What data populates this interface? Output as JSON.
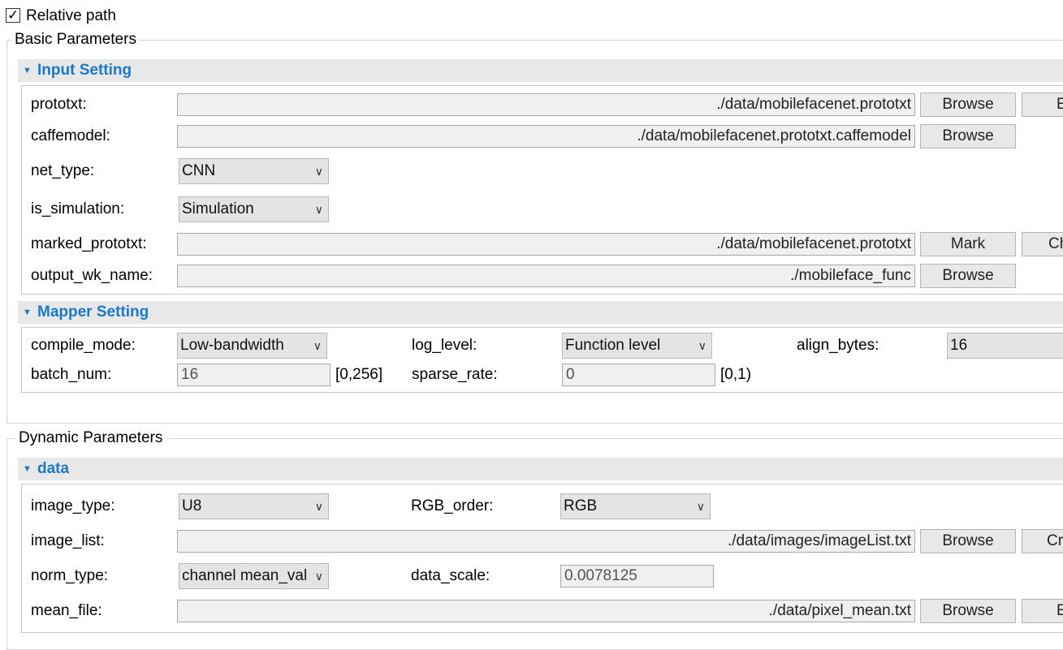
{
  "relative_path": {
    "label": "Relative path",
    "checked": true
  },
  "basic": {
    "group_title": "Basic Parameters",
    "input_setting": {
      "title": "Input Setting",
      "prototxt": {
        "label": "prototxt:",
        "value": "./data/mobilefacenet.prototxt",
        "button": "Browse",
        "extra_button": "E"
      },
      "caffemodel": {
        "label": "caffemodel:",
        "value": "./data/mobilefacenet.prototxt.caffemodel",
        "button": "Browse"
      },
      "net_type": {
        "label": "net_type:",
        "value": "CNN"
      },
      "is_simulation": {
        "label": "is_simulation:",
        "value": "Simulation"
      },
      "marked_prototxt": {
        "label": "marked_prototxt:",
        "value": "./data/mobilefacenet.prototxt",
        "button": "Mark",
        "extra_button": "Ch"
      },
      "output_wk_name": {
        "label": "output_wk_name:",
        "value": "./mobileface_func",
        "button": "Browse"
      }
    },
    "mapper_setting": {
      "title": "Mapper Setting",
      "compile_mode": {
        "label": "compile_mode:",
        "value": "Low-bandwidth"
      },
      "log_level": {
        "label": "log_level:",
        "value": "Function level"
      },
      "align_bytes": {
        "label": "align_bytes:",
        "value": "16"
      },
      "batch_num": {
        "label": "batch_num:",
        "value": "16",
        "range": "[0,256]"
      },
      "sparse_rate": {
        "label": "sparse_rate:",
        "value": "0",
        "range": "[0,1)"
      }
    }
  },
  "dynamic": {
    "group_title": "Dynamic Parameters",
    "data_section": {
      "title": "data",
      "image_type": {
        "label": "image_type:",
        "value": "U8"
      },
      "rgb_order": {
        "label": "RGB_order:",
        "value": "RGB"
      },
      "image_list": {
        "label": "image_list:",
        "value": "./data/images/imageList.txt",
        "button": "Browse",
        "extra_button": "Cr"
      },
      "norm_type": {
        "label": "norm_type:",
        "value": "channel mean_val"
      },
      "data_scale": {
        "label": "data_scale:",
        "value": "0.0078125"
      },
      "mean_file": {
        "label": "mean_file:",
        "value": "./data/pixel_mean.txt",
        "button": "Browse",
        "extra_button": "E"
      }
    }
  },
  "colors": {
    "section_title": "#1a7ac9",
    "section_bar": "#e8e8e8",
    "field_bg": "#f0f0f0"
  },
  "icons": {
    "checkbox": "check-icon",
    "section_toggle": "collapse-arrow-icon",
    "dropdown": "chevron-down-icon"
  }
}
